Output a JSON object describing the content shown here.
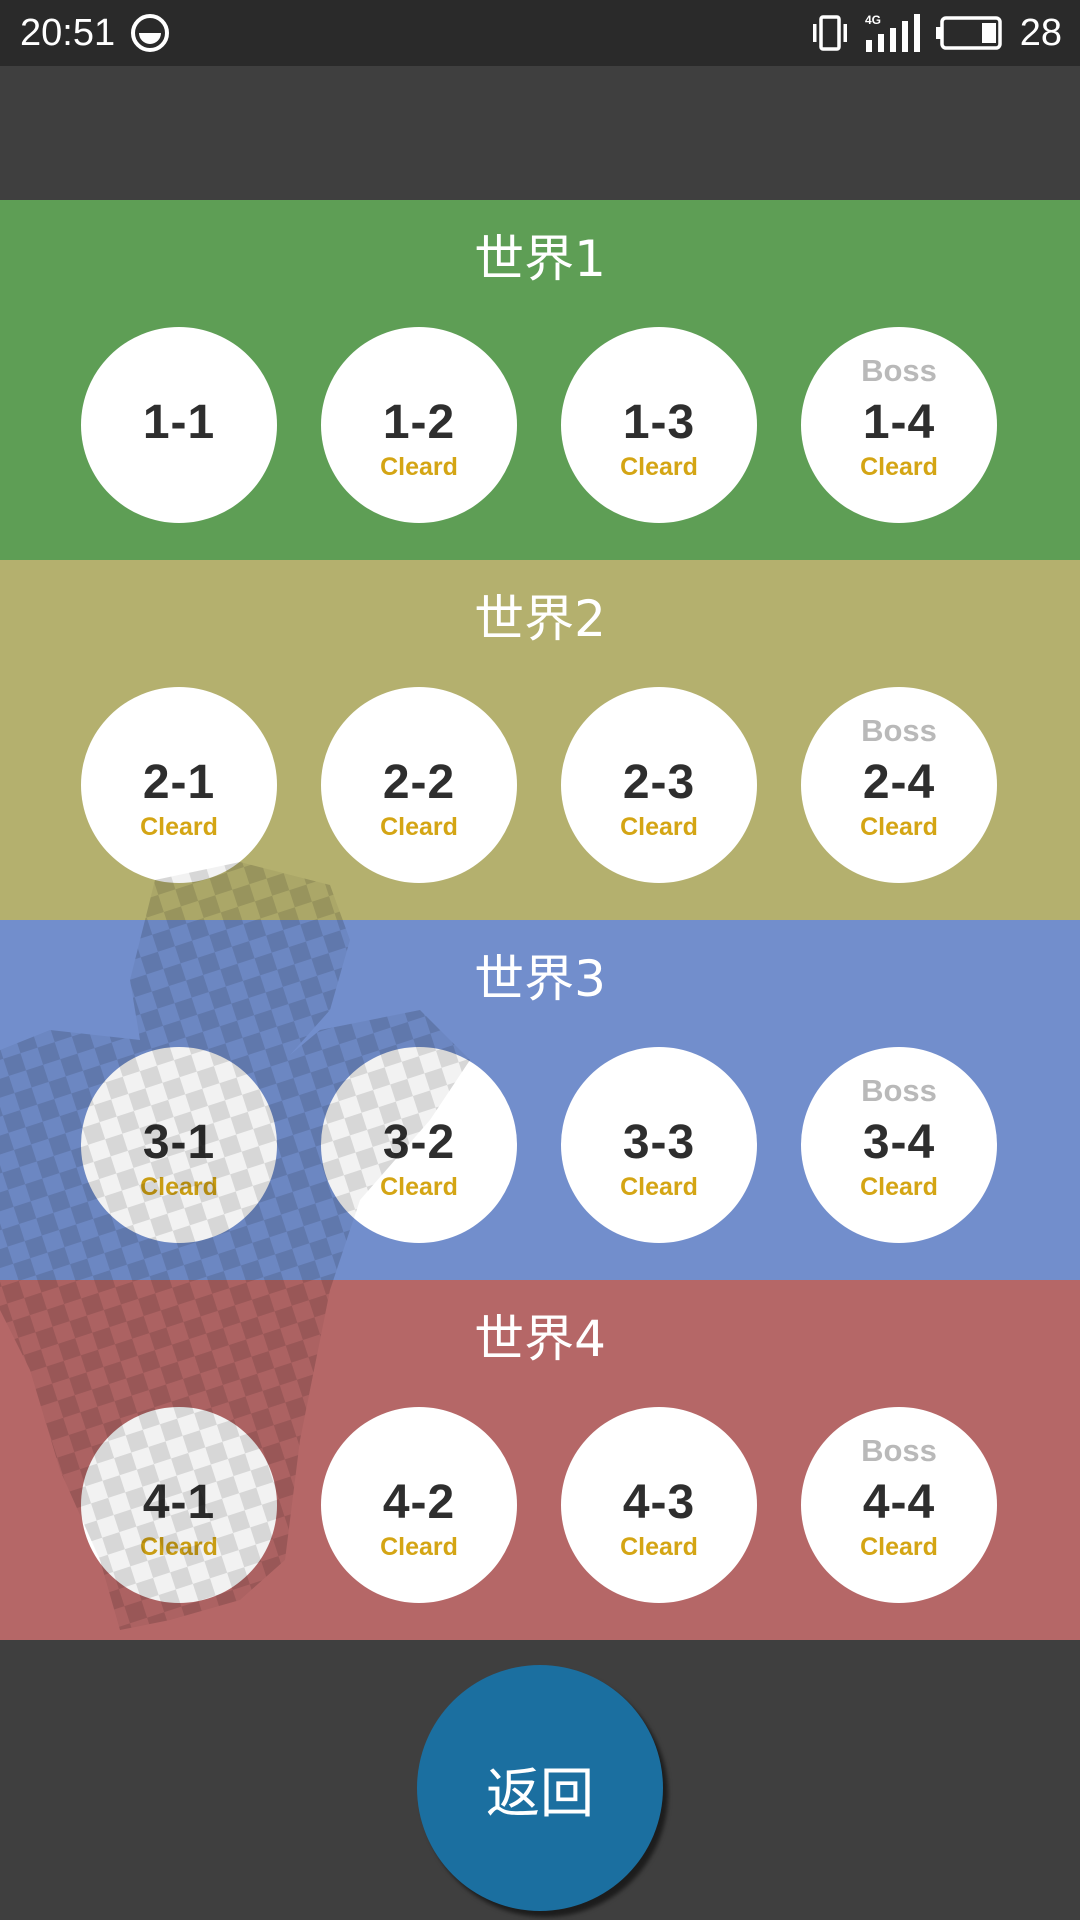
{
  "status_bar": {
    "time": "20:51",
    "app_icon": "circle-face-icon",
    "vibrate_icon": "vibrate-icon",
    "network_type": "4G",
    "signal_icon": "signal-bars-icon",
    "battery_icon": "battery-icon",
    "battery_level": "28"
  },
  "worlds": [
    {
      "title": "世界1",
      "color": "#5e9e55",
      "stages": [
        {
          "label": "1-1",
          "boss": "",
          "status": ""
        },
        {
          "label": "1-2",
          "boss": "",
          "status": "Cleard"
        },
        {
          "label": "1-3",
          "boss": "",
          "status": "Cleard"
        },
        {
          "label": "1-4",
          "boss": "Boss",
          "status": "Cleard"
        }
      ]
    },
    {
      "title": "世界2",
      "color": "#b4b06e",
      "stages": [
        {
          "label": "2-1",
          "boss": "",
          "status": "Cleard"
        },
        {
          "label": "2-2",
          "boss": "",
          "status": "Cleard"
        },
        {
          "label": "2-3",
          "boss": "",
          "status": "Cleard"
        },
        {
          "label": "2-4",
          "boss": "Boss",
          "status": "Cleard"
        }
      ]
    },
    {
      "title": "世界3",
      "color": "#728ecc",
      "stages": [
        {
          "label": "3-1",
          "boss": "",
          "status": "Cleard"
        },
        {
          "label": "3-2",
          "boss": "",
          "status": "Cleard"
        },
        {
          "label": "3-3",
          "boss": "",
          "status": "Cleard"
        },
        {
          "label": "3-4",
          "boss": "Boss",
          "status": "Cleard"
        }
      ]
    },
    {
      "title": "世界4",
      "color": "#b56767",
      "stages": [
        {
          "label": "4-1",
          "boss": "",
          "status": "Cleard"
        },
        {
          "label": "4-2",
          "boss": "",
          "status": "Cleard"
        },
        {
          "label": "4-3",
          "boss": "",
          "status": "Cleard"
        },
        {
          "label": "4-4",
          "boss": "Boss",
          "status": "Cleard"
        }
      ]
    }
  ],
  "back_button": {
    "label": "返回",
    "color": "#1b6fa0"
  },
  "colors": {
    "background": "#3f3f3f",
    "status_bar": "#2a2a2a",
    "stage_text": "#2e2e2e",
    "cleared_text": "#d4a514",
    "boss_text": "#b9b9b9"
  }
}
